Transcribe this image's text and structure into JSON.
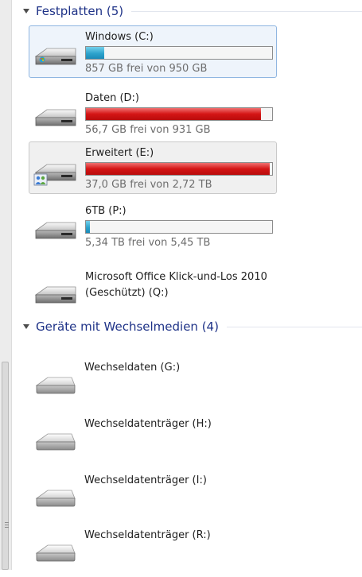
{
  "groups": [
    {
      "title": "Festplatten (5)",
      "drives": [
        {
          "name": "Windows (C:)",
          "free_text": "857 GB frei von 950 GB",
          "used_fraction": 0.098,
          "bar_color": "#2ea3cc",
          "icon": "hard-drive-windows-icon",
          "state": "selected"
        },
        {
          "name": "Daten (D:)",
          "free_text": "56,7 GB frei von 931 GB",
          "used_fraction": 0.939,
          "bar_color": "#d41515",
          "icon": "hard-drive-icon",
          "state": "normal"
        },
        {
          "name": "Erweitert (E:)",
          "free_text": "37,0 GB frei von 2,72 TB",
          "used_fraction": 0.987,
          "bar_color": "#d41515",
          "icon": "hard-drive-shared-icon",
          "state": "hover"
        },
        {
          "name": "6TB (P:)",
          "free_text": "5,34 TB frei von 5,45 TB",
          "used_fraction": 0.02,
          "bar_color": "#2ea3cc",
          "icon": "hard-drive-icon",
          "state": "normal"
        },
        {
          "name": "Microsoft Office Klick-und-Los 2010 (Geschützt) (Q:)",
          "icon": "hard-drive-icon",
          "state": "normal"
        }
      ]
    },
    {
      "title": "Geräte mit Wechselmedien (4)",
      "drives": [
        {
          "name": "Wechseldaten (G:)",
          "icon": "removable-drive-icon"
        },
        {
          "name": "Wechseldatenträger (H:)",
          "icon": "removable-drive-icon"
        },
        {
          "name": "Wechseldatenträger (I:)",
          "icon": "removable-drive-icon"
        },
        {
          "name": "Wechseldatenträger (R:)",
          "icon": "removable-drive-icon"
        }
      ]
    }
  ]
}
